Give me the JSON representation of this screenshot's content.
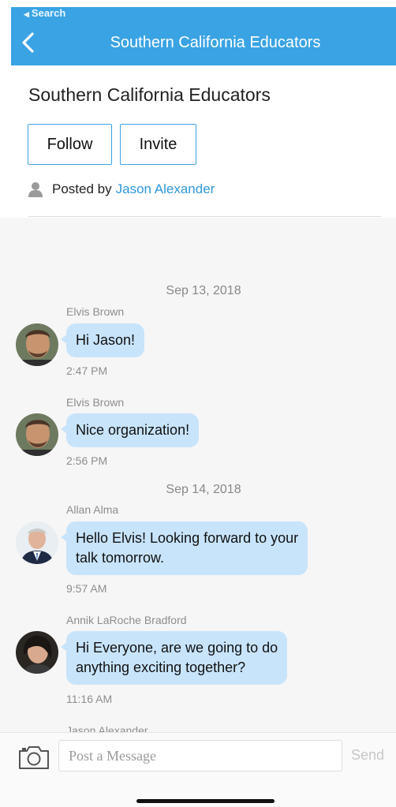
{
  "nav": {
    "back_app": "Search",
    "title": "Southern California Educators"
  },
  "group": {
    "title": "Southern California Educators",
    "follow_label": "Follow",
    "invite_label": "Invite",
    "posted_by_prefix": "Posted by",
    "posted_by_author": "Jason Alexander"
  },
  "feed": {
    "dates": [
      "Sep 13, 2018",
      "Sep 14, 2018"
    ],
    "messages": [
      {
        "sender": "Elvis Brown",
        "text": "Hi Jason!",
        "time": "2:47 PM",
        "avatar": "elvis-avatar"
      },
      {
        "sender": "Elvis Brown",
        "text": "Nice organization!",
        "time": "2:56 PM",
        "avatar": "elvis-avatar"
      },
      {
        "sender": "Allan Alma",
        "text": "Hello Elvis! Looking forward to your\ntalk tomorrow.",
        "time": "9:57 AM",
        "avatar": "allan-avatar"
      },
      {
        "sender": "Annik LaRoche Bradford",
        "text": "Hi Everyone, are we going to do\nanything exciting together?",
        "time": "11:16 AM",
        "avatar": "annik-avatar"
      },
      {
        "sender": "Jason Alexander"
      }
    ]
  },
  "composer": {
    "placeholder": "Post a Message",
    "send_label": "Send",
    "camera_icon": "camera-icon"
  },
  "colors": {
    "accent": "#3aa3e3",
    "bubble": "#c8e4fb",
    "link": "#2e97d8"
  }
}
